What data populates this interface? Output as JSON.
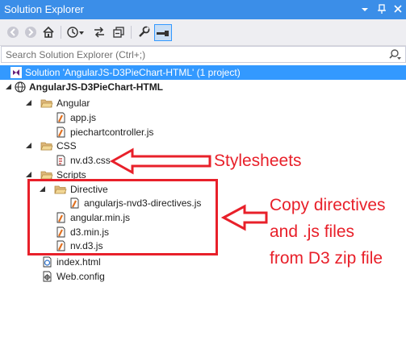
{
  "window": {
    "title": "Solution Explorer"
  },
  "search": {
    "placeholder": "Search Solution Explorer (Ctrl+;)"
  },
  "tree": {
    "solution_label": "Solution 'AngularJS-D3PieChart-HTML' (1 project)",
    "project_label": "AngularJS-D3PieChart-HTML",
    "folder_angular": "Angular",
    "file_appjs": "app.js",
    "file_piechartcontroller": "piechartcontroller.js",
    "folder_css": "CSS",
    "file_nvd3css": "nv.d3.css",
    "folder_scripts": "Scripts",
    "folder_directive": "Directive",
    "file_angularjs_nvd3_directives": "angularjs-nvd3-directives.js",
    "file_angular_min": "angular.min.js",
    "file_d3_min": "d3.min.js",
    "file_nvd3js": "nv.d3.js",
    "file_index": "index.html",
    "file_webconfig": "Web.config"
  },
  "annotations": {
    "stylesheets": "Stylesheets",
    "copy_line1": "Copy directives",
    "copy_line2": "and .js files",
    "copy_line3": "from D3 zip file"
  },
  "colors": {
    "titlebar": "#3b8ee8",
    "selection": "#3399ff",
    "annotation_red": "#e8202a"
  }
}
